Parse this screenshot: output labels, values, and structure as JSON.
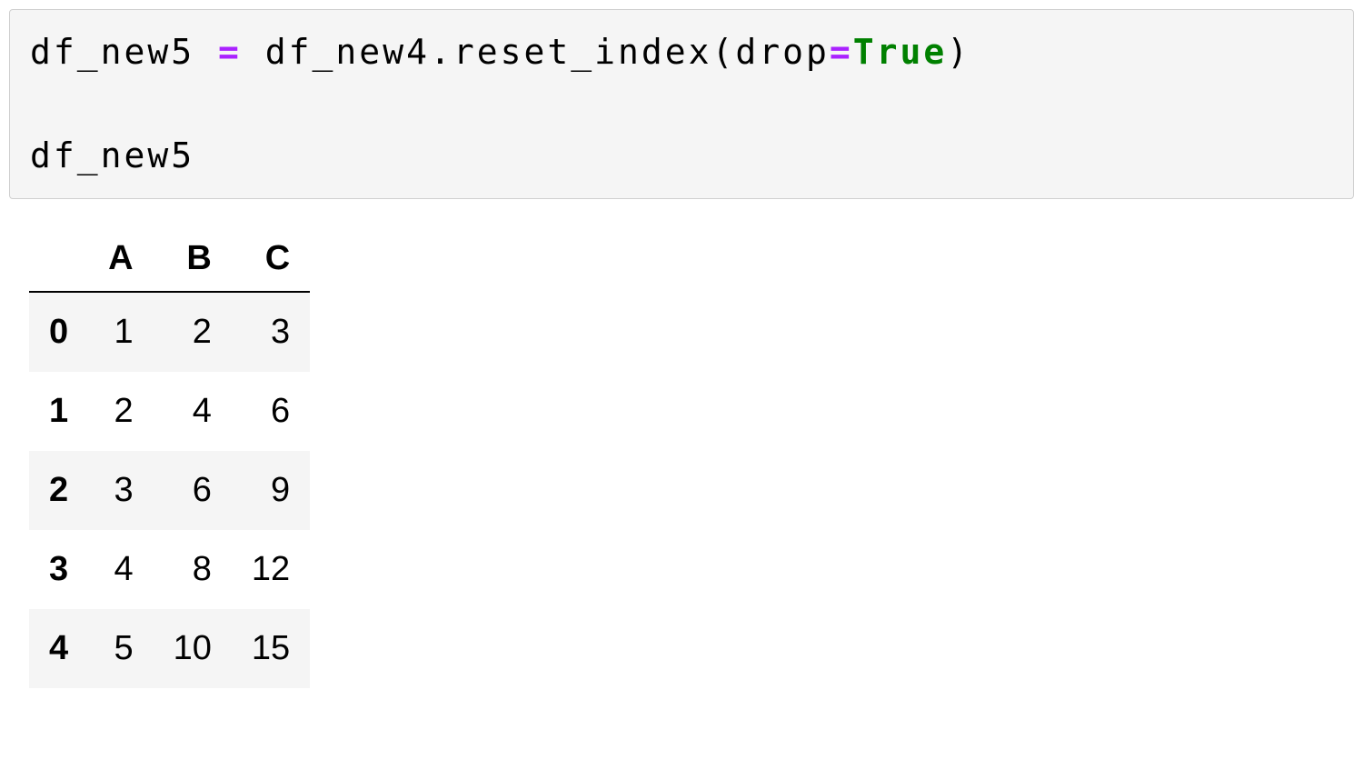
{
  "code": {
    "part1": "df_new5 ",
    "op1": "=",
    "part2": " df_new4",
    "dot": ".",
    "method": "reset_index(drop",
    "op2": "=",
    "kw": "True",
    "part3": ")",
    "line2": "df_new5"
  },
  "dataframe": {
    "columns": [
      "A",
      "B",
      "C"
    ],
    "index": [
      "0",
      "1",
      "2",
      "3",
      "4"
    ],
    "rows": [
      [
        "1",
        "2",
        "3"
      ],
      [
        "2",
        "4",
        "6"
      ],
      [
        "3",
        "6",
        "9"
      ],
      [
        "4",
        "8",
        "12"
      ],
      [
        "5",
        "10",
        "15"
      ]
    ]
  }
}
